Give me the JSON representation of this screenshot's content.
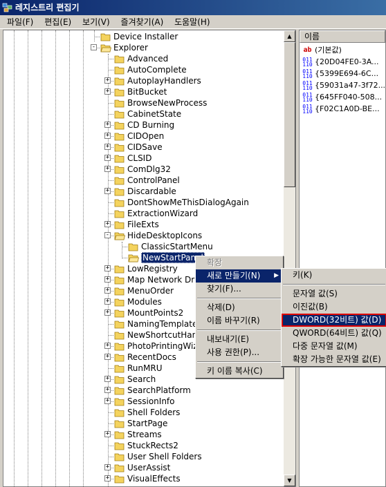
{
  "window": {
    "title": "레지스트리 편집기"
  },
  "menubar": [
    "파일(F)",
    "편집(E)",
    "보기(V)",
    "즐겨찾기(A)",
    "도움말(H)"
  ],
  "tree": {
    "items": [
      {
        "label": "Device Installer",
        "level": 1,
        "expander": "none"
      },
      {
        "label": "Explorer",
        "level": 1,
        "expander": "minus"
      },
      {
        "label": "Advanced",
        "level": 2,
        "expander": "none"
      },
      {
        "label": "AutoComplete",
        "level": 2,
        "expander": "none"
      },
      {
        "label": "AutoplayHandlers",
        "level": 2,
        "expander": "plus"
      },
      {
        "label": "BitBucket",
        "level": 2,
        "expander": "plus"
      },
      {
        "label": "BrowseNewProcess",
        "level": 2,
        "expander": "none"
      },
      {
        "label": "CabinetState",
        "level": 2,
        "expander": "none"
      },
      {
        "label": "CD Burning",
        "level": 2,
        "expander": "plus"
      },
      {
        "label": "CIDOpen",
        "level": 2,
        "expander": "plus"
      },
      {
        "label": "CIDSave",
        "level": 2,
        "expander": "plus"
      },
      {
        "label": "CLSID",
        "level": 2,
        "expander": "plus"
      },
      {
        "label": "ComDlg32",
        "level": 2,
        "expander": "plus"
      },
      {
        "label": "ControlPanel",
        "level": 2,
        "expander": "none"
      },
      {
        "label": "Discardable",
        "level": 2,
        "expander": "plus"
      },
      {
        "label": "DontShowMeThisDialogAgain",
        "level": 2,
        "expander": "none"
      },
      {
        "label": "ExtractionWizard",
        "level": 2,
        "expander": "none"
      },
      {
        "label": "FileExts",
        "level": 2,
        "expander": "plus"
      },
      {
        "label": "HideDesktopIcons",
        "level": 2,
        "expander": "minus"
      },
      {
        "label": "ClassicStartMenu",
        "level": 3,
        "expander": "none"
      },
      {
        "label": "NewStartPanel",
        "level": 3,
        "expander": "none",
        "selected": true
      },
      {
        "label": "LowRegistry",
        "level": 2,
        "expander": "plus"
      },
      {
        "label": "Map Network Drive",
        "level": 2,
        "expander": "plus"
      },
      {
        "label": "MenuOrder",
        "level": 2,
        "expander": "plus"
      },
      {
        "label": "Modules",
        "level": 2,
        "expander": "plus"
      },
      {
        "label": "MountPoints2",
        "level": 2,
        "expander": "plus"
      },
      {
        "label": "NamingTemplates",
        "level": 2,
        "expander": "none"
      },
      {
        "label": "NewShortcutHandlers",
        "level": 2,
        "expander": "none"
      },
      {
        "label": "PhotoPrintingWizard",
        "level": 2,
        "expander": "plus"
      },
      {
        "label": "RecentDocs",
        "level": 2,
        "expander": "plus"
      },
      {
        "label": "RunMRU",
        "level": 2,
        "expander": "none"
      },
      {
        "label": "Search",
        "level": 2,
        "expander": "plus"
      },
      {
        "label": "SearchPlatform",
        "level": 2,
        "expander": "plus"
      },
      {
        "label": "SessionInfo",
        "level": 2,
        "expander": "plus"
      },
      {
        "label": "Shell Folders",
        "level": 2,
        "expander": "none"
      },
      {
        "label": "StartPage",
        "level": 2,
        "expander": "none"
      },
      {
        "label": "Streams",
        "level": 2,
        "expander": "plus"
      },
      {
        "label": "StuckRects2",
        "level": 2,
        "expander": "none"
      },
      {
        "label": "User Shell Folders",
        "level": 2,
        "expander": "none"
      },
      {
        "label": "UserAssist",
        "level": 2,
        "expander": "plus"
      },
      {
        "label": "VisualEffects",
        "level": 2,
        "expander": "plus"
      }
    ]
  },
  "list": {
    "header": "이름",
    "items": [
      {
        "icon": "string-value-icon",
        "label": "(기본값)"
      },
      {
        "icon": "binary-value-icon",
        "label": "{20D04FE0-3A..."
      },
      {
        "icon": "binary-value-icon",
        "label": "{5399E694-6C..."
      },
      {
        "icon": "binary-value-icon",
        "label": "{59031a47-3f72..."
      },
      {
        "icon": "binary-value-icon",
        "label": "{645FF040-508..."
      },
      {
        "icon": "binary-value-icon",
        "label": "{F02C1A0D-BE..."
      }
    ]
  },
  "context_menu": {
    "items": [
      {
        "label": "확장",
        "disabled": true
      },
      {
        "label": "새로 만들기(N)",
        "highlighted": true,
        "submenu": true
      },
      {
        "label": "찾기(F)..."
      },
      {
        "separator": true
      },
      {
        "label": "삭제(D)"
      },
      {
        "label": "이름 바꾸기(R)"
      },
      {
        "separator": true
      },
      {
        "label": "내보내기(E)"
      },
      {
        "label": "사용 권한(P)..."
      },
      {
        "separator": true
      },
      {
        "label": "키 이름 복사(C)"
      }
    ]
  },
  "submenu": {
    "items": [
      {
        "label": "키(K)"
      },
      {
        "separator": true
      },
      {
        "label": "문자열 값(S)"
      },
      {
        "label": "이진값(B)"
      },
      {
        "label": "DWORD(32비트) 값(D)",
        "highlighted": true,
        "boxed": true
      },
      {
        "label": "QWORD(64비트) 값(Q)"
      },
      {
        "label": "다중 문자열 값(M)"
      },
      {
        "label": "확장 가능한 문자열 값(E)"
      }
    ]
  },
  "colors": {
    "selection": "#0a246a",
    "face": "#d4d0c8",
    "highlight_box": "#e00000"
  }
}
